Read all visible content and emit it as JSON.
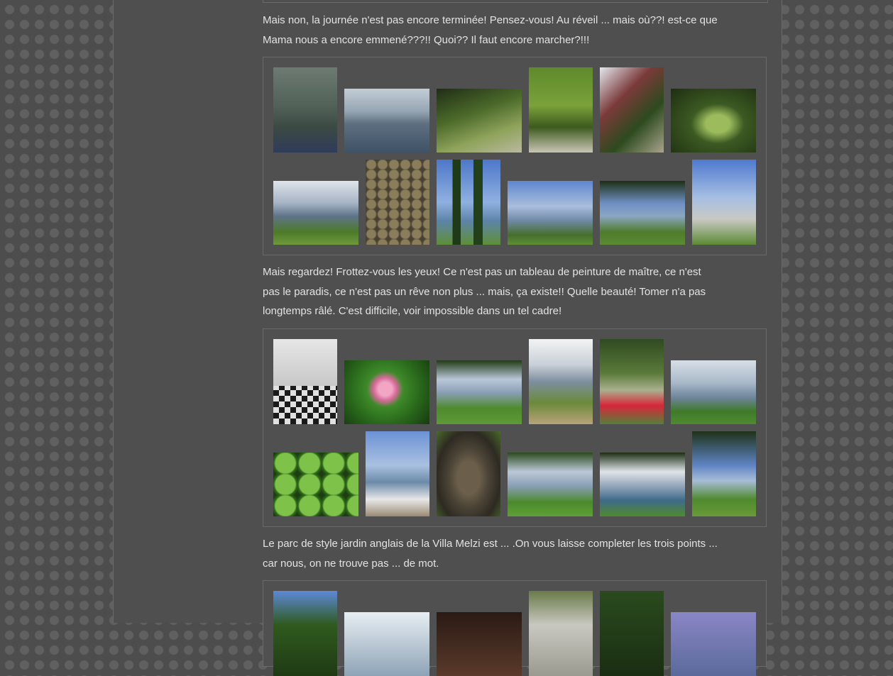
{
  "paragraphs": {
    "p1_line1": "Mais non, la journée n'est pas encore terminée! Pensez-vous! Au réveil ... mais où??! est-ce que",
    "p1_line2": "Mama nous a encore emmené???!! Quoi?? Il faut encore marcher?!!!",
    "p2_line1": "Mais regardez! Frottez-vous les yeux! Ce n'est pas un tableau de peinture de maître, ce n'est",
    "p2_line2": "pas le paradis, ce n'est pas un rêve non plus ... mais, ça existe!! Quelle beauté! Tomer n'a pas",
    "p2_line3": "longtemps râlé. C'est difficile, voir impossible dans un tel cadre!",
    "p3_line1": "Le parc de style jardin anglais de la Villa Melzi est  ... .On vous laisse completer les trois points ...",
    "p3_line2": "car nous, on ne trouve pas ... de mot."
  },
  "colors": {
    "page_background": "#4f4f4f",
    "text": "#e3e3e3",
    "gallery_border": "#6a6a6a"
  }
}
